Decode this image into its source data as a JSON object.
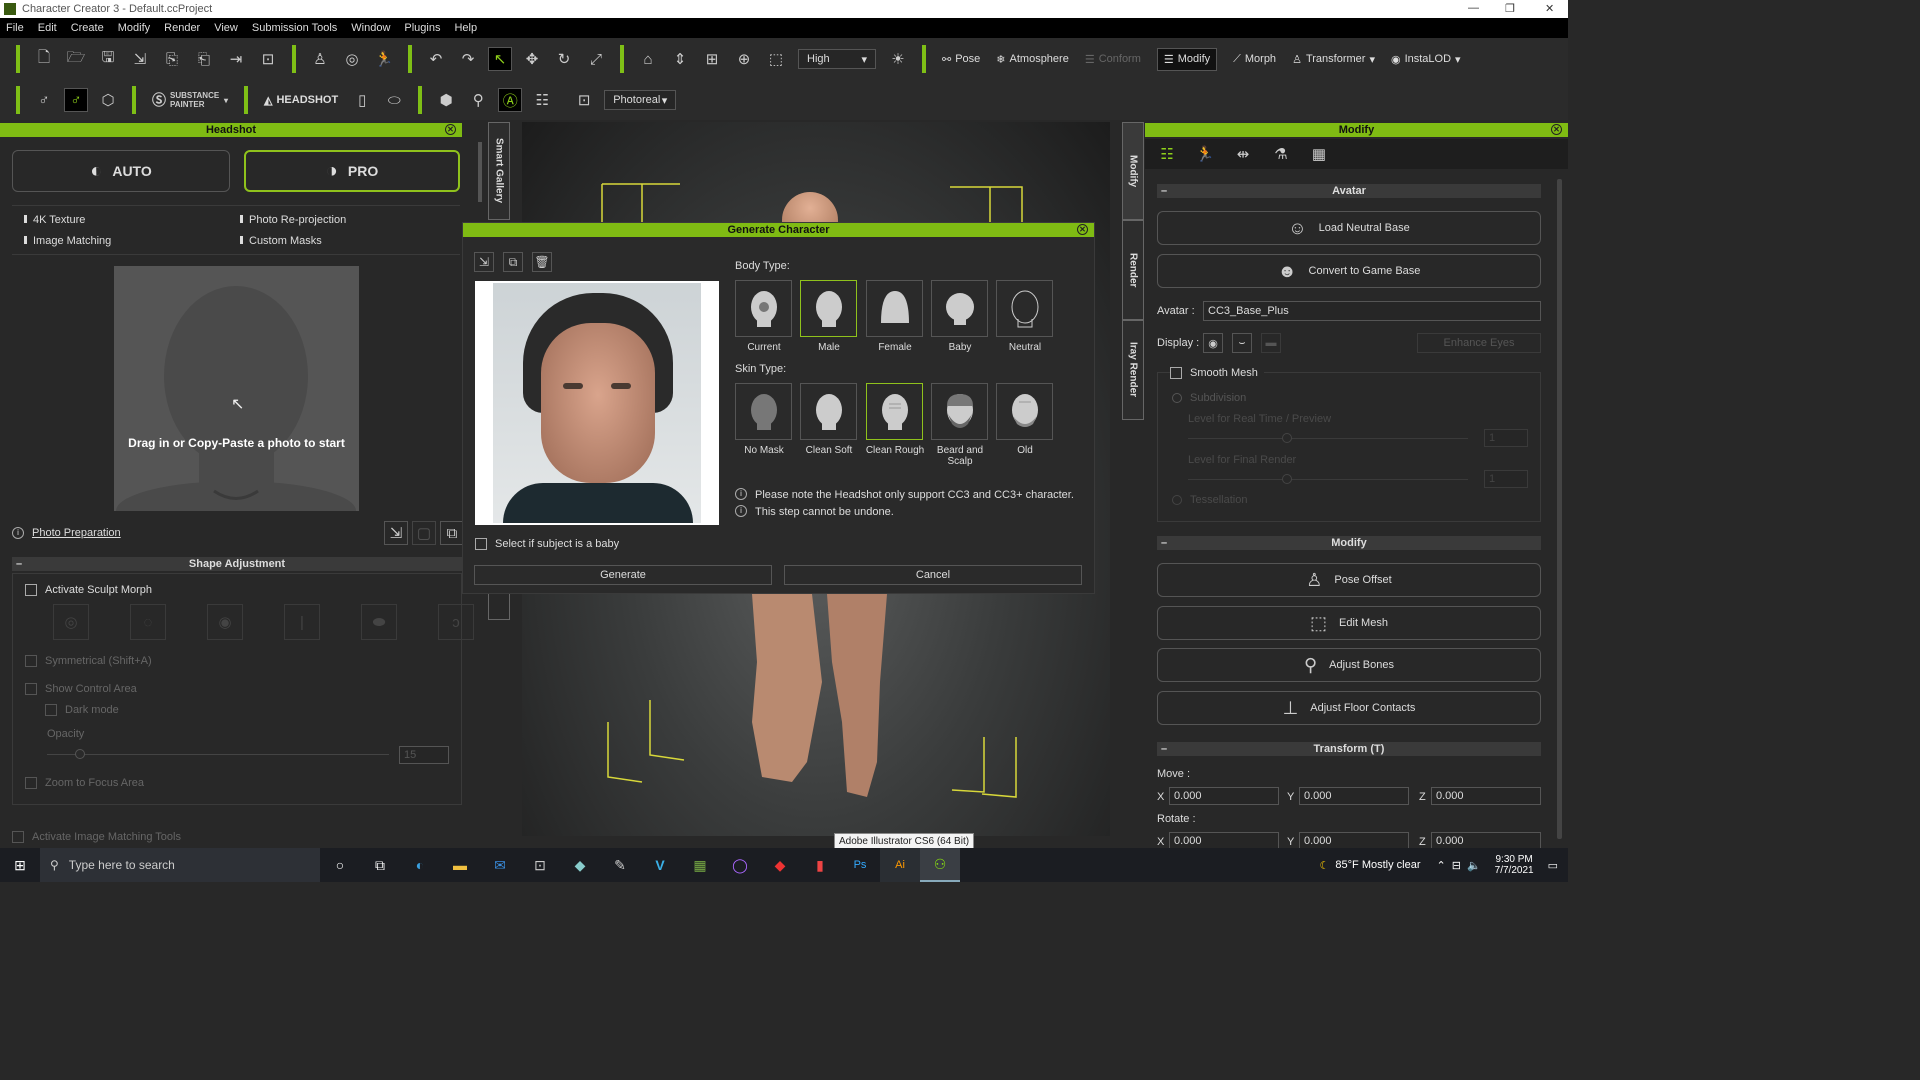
{
  "window": {
    "title": "Character Creator 3 - Default.ccProject"
  },
  "menu": [
    "File",
    "Edit",
    "Create",
    "Modify",
    "Render",
    "View",
    "Submission Tools",
    "Window",
    "Plugins",
    "Help"
  ],
  "toolbar": {
    "quality": "High",
    "pose": "Pose",
    "atmosphere": "Atmosphere",
    "conform": "Conform",
    "modify": "Modify",
    "morph": "Morph",
    "transformer": "Transformer",
    "instalod": "InstaLOD",
    "substance": "SUBSTANCE PAINTER",
    "headshot": "HEADSHOT",
    "render_mode": "Photoreal"
  },
  "left": {
    "title": "Headshot",
    "auto": "AUTO",
    "pro": "PRO",
    "features": [
      "4K Texture",
      "Photo Re-projection",
      "Image Matching",
      "Custom Masks"
    ],
    "dropzone": "Drag in or Copy-Paste a photo to start",
    "photo_prep": "Photo Preparation",
    "shape_adjust": "Shape Adjustment",
    "activate_sculpt": "Activate Sculpt Morph",
    "symmetrical": "Symmetrical (Shift+A)",
    "show_control": "Show Control Area",
    "dark_mode": "Dark mode",
    "opacity": "Opacity",
    "opacity_value": "15",
    "zoom_focus": "Zoom to Focus Area",
    "image_matching_tools": "Activate Image Matching Tools"
  },
  "side_tabs": {
    "smart_gallery": "Smart Gallery",
    "modify": "Modify",
    "render": "Render",
    "iray": "Iray Render"
  },
  "dialog": {
    "title": "Generate Character",
    "body_type_label": "Body Type:",
    "body_types": [
      "Current",
      "Male",
      "Female",
      "Baby",
      "Neutral"
    ],
    "body_selected": "Male",
    "skin_type_label": "Skin Type:",
    "skin_types": [
      "No Mask",
      "Clean Soft",
      "Clean Rough",
      "Beard and Scalp",
      "Old"
    ],
    "skin_selected": "Clean Rough",
    "note1": "Please note the Headshot only support CC3 and CC3+ character.",
    "note2": "This step cannot be undone.",
    "baby_check": "Select if subject is a baby",
    "generate": "Generate",
    "cancel": "Cancel"
  },
  "right": {
    "title": "Modify",
    "avatar_section": "Avatar",
    "load_neutral": "Load Neutral Base",
    "convert_game": "Convert to Game Base",
    "avatar_label": "Avatar :",
    "avatar_value": "CC3_Base_Plus",
    "display_label": "Display :",
    "enhance_eyes": "Enhance Eyes",
    "smooth_mesh": "Smooth Mesh",
    "subdivision": "Subdivision",
    "level_realtime": "Level for Real Time / Preview",
    "level_final": "Level for Final Render",
    "level_value": "1",
    "tessellation": "Tessellation",
    "modify_section": "Modify",
    "pose_offset": "Pose Offset",
    "edit_mesh": "Edit Mesh",
    "adjust_bones": "Adjust Bones",
    "adjust_floor": "Adjust Floor Contacts",
    "transform_section": "Transform (T)",
    "move_label": "Move :",
    "rotate_label": "Rotate :",
    "x": "X",
    "y": "Y",
    "z": "Z",
    "move": [
      "0.000",
      "0.000",
      "0.000"
    ],
    "rotate": [
      "0.000",
      "0.000",
      "0.000"
    ]
  },
  "tooltip": "Adobe Illustrator CS6 (64 Bit)",
  "taskbar": {
    "search_placeholder": "Type here to search",
    "weather": "85°F  Mostly clear",
    "time": "9:30 PM",
    "date": "7/7/2021"
  },
  "colors": {
    "accent": "#7fbb13",
    "panel": "#282828"
  }
}
